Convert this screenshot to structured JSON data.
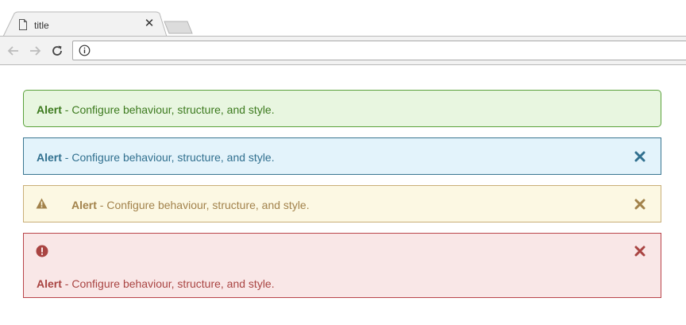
{
  "browser": {
    "tab_title": "title",
    "tab_close": "✕",
    "address": ""
  },
  "alerts": [
    {
      "type": "success",
      "strong": "Alert",
      "text": " - Configure behaviour, structure, and style.",
      "color": "#3c7a1e"
    },
    {
      "type": "info",
      "strong": "Alert",
      "text": " - Configure behaviour, structure, and style.",
      "color": "#31708f"
    },
    {
      "type": "warning",
      "strong": "Alert",
      "text": " - Configure behaviour, structure, and style.",
      "color": "#a2824b"
    },
    {
      "type": "danger",
      "strong": "Alert",
      "text": " - Configure behaviour, structure, and style.",
      "color": "#a94442"
    }
  ],
  "icons": {
    "tab": "page-icon",
    "back": "arrow-left-icon",
    "forward": "arrow-right-icon",
    "reload": "reload-icon",
    "info": "info-icon",
    "warning": "warning-triangle-icon",
    "danger": "exclamation-circle-icon",
    "close": "close-icon"
  }
}
